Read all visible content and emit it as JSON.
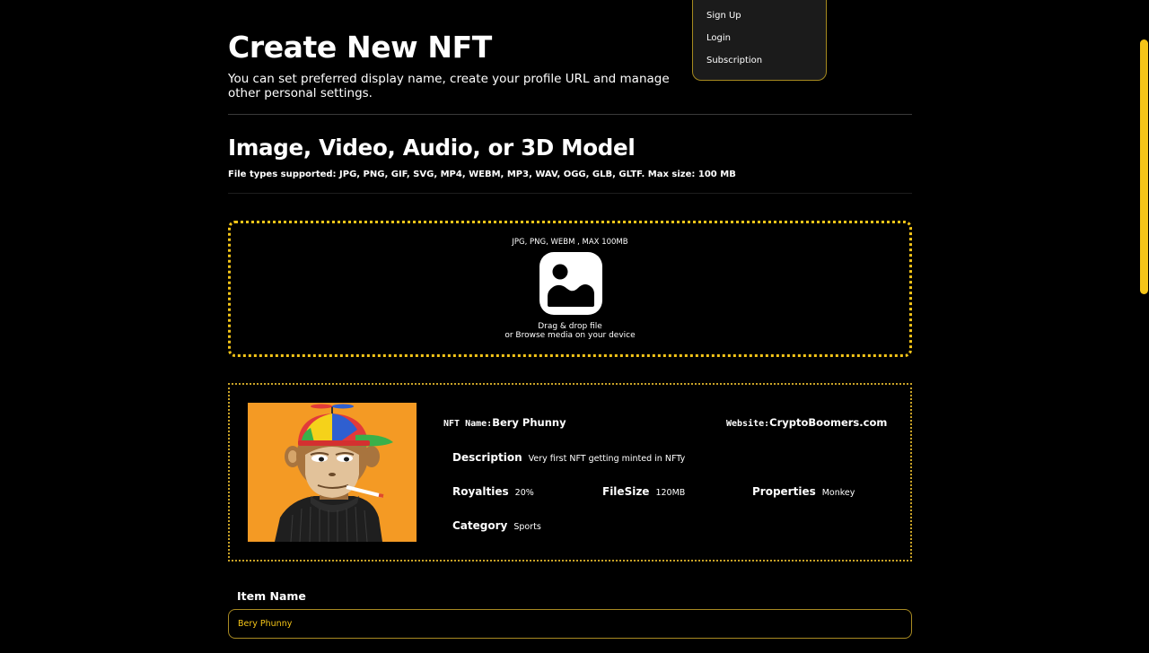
{
  "menu": {
    "items": [
      "Sign Up",
      "Login",
      "Subscription"
    ]
  },
  "header": {
    "title": "Create New NFT",
    "subtitle": "You can set preferred display name, create your profile URL and manage other personal settings."
  },
  "upload_section": {
    "title": "Image, Video, Audio, or 3D Model",
    "file_types": "File types supported: JPG, PNG, GIF, SVG, MP4, WEBM, MP3, WAV, OGG, GLB, GLTF. Max size: 100 MB",
    "dropzone": {
      "formats": "JPG, PNG, WEBM , MAX 100MB",
      "line1": "Drag & drop file",
      "line2": "or Browse media on your device",
      "icon": "image-icon"
    }
  },
  "preview": {
    "nft_name_label": "NFT Name:",
    "nft_name": "Bery Phunny",
    "website_label": "Website:",
    "website": "CryptoBoomers.com",
    "description_label": "Description",
    "description": "Very first NFT getting minted in NFTy",
    "royalties_label": "Royalties",
    "royalties": "20%",
    "filesize_label": "FileSize",
    "filesize": "120MB",
    "properties_label": "Properties",
    "properties": "Monkey",
    "category_label": "Category",
    "category": "Sports"
  },
  "form": {
    "item_name_label": "Item Name",
    "item_name_value": "Bery Phunny"
  },
  "colors": {
    "accent": "#f5c518",
    "background": "#000000",
    "image_background": "#f49a24"
  }
}
